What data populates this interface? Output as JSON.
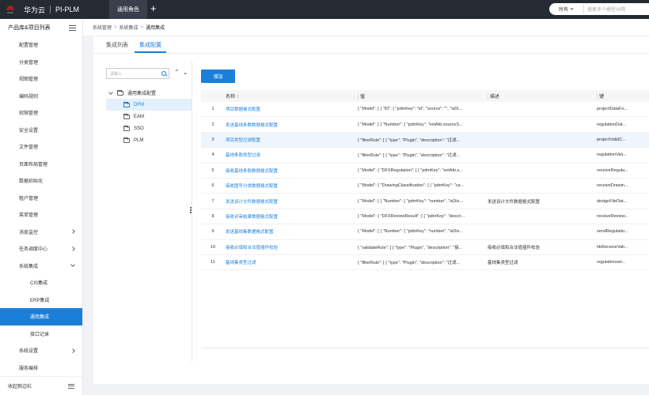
{
  "topbar": {
    "logo_text": "HUAWEI",
    "brand_company": "华为云",
    "brand_app": "PI-PLM",
    "active_tab": "通用角色",
    "add_tab_glyph": "+",
    "search_scope": "所有",
    "search_placeholder": "搜索多个模型分隔"
  },
  "sidebar": {
    "title": "产品库&项目列表",
    "items": [
      {
        "label": "配置管理"
      },
      {
        "label": "分类管理"
      },
      {
        "label": "视图管理"
      },
      {
        "label": "编码规则"
      },
      {
        "label": "权限管理"
      },
      {
        "label": "安全设置"
      },
      {
        "label": "文件管理"
      },
      {
        "label": "页面布局管理"
      },
      {
        "label": "数据初始化"
      },
      {
        "label": "租户管理"
      },
      {
        "label": "菜单管理"
      },
      {
        "label": "消息监控"
      },
      {
        "label": "任务调度中心"
      },
      {
        "label": "系统集成"
      },
      {
        "label": "CIS集成"
      },
      {
        "label": "ERP集成"
      },
      {
        "label": "通用集成"
      },
      {
        "label": "接口记录"
      },
      {
        "label": "系统设置"
      },
      {
        "label": "服务编排"
      }
    ],
    "footer": "收起侧边栏"
  },
  "breadcrumb": [
    "系统管理",
    "系统集成",
    "通用集成"
  ],
  "breadcrumb_sep": ">",
  "tabs": [
    "集成列表",
    "集成配置"
  ],
  "tree": {
    "search_placeholder": "请输入",
    "root": "通用集成配置",
    "children": [
      "DFM",
      "EAM",
      "SSO",
      "PLM"
    ]
  },
  "add_button": "增加",
  "table": {
    "headers": {
      "name": "名称",
      "value": "值",
      "desc": "描述",
      "key": "键"
    },
    "rows": [
      {
        "idx": "1",
        "name": "项目数据格式配置",
        "value": "{ \"Model\": [ { \"ID\": { \"pdmKey\": \"id\", \"source\": \"\", \"isDi...",
        "desc": "",
        "key": "projectDataFo..."
      },
      {
        "idx": "2",
        "name": "发送基线条数数据格式配置",
        "value": "{ \"Model\": [ { \"Number\": { \"pdmKey\": \"extAttr.sourceS...",
        "desc": "",
        "key": "regulationDat..."
      },
      {
        "idx": "3",
        "name": "项目类型过滤配置",
        "value": "{ \"filterRule\": [ { \"type\": \"Plugin\", \"description\": \"过滤...",
        "desc": "",
        "key": "projectValidC..."
      },
      {
        "idx": "4",
        "name": "基线条款类型过滤",
        "value": "{ \"filterRule\": [ { \"type\": \"Plugin\", \"description\": \"过滤...",
        "desc": "",
        "key": "regulationVali..."
      },
      {
        "idx": "5",
        "name": "接收基线条款数据格式配置",
        "value": "{ \"Model\": { \"DFXRegulation\": [ { \"pdmKey\": \"extAttr.s...",
        "desc": "",
        "key": "receiveRegula..."
      },
      {
        "idx": "6",
        "name": "接收图号分类数据格式配置",
        "value": "{ \"Model\": { \"DrawingClassification\": [ { \"pdmKey\": \"ca...",
        "desc": "",
        "key": "receiveDrawin..."
      },
      {
        "idx": "7",
        "name": "发送设计文件数据格式配置",
        "value": "{ \"Model\": [ { \"Number\": { \"pdmKey\": \"number\", \"isDis...",
        "desc": "发送设计文件数据格式配置",
        "key": "designFileDat..."
      },
      {
        "idx": "8",
        "name": "接收评审结果数据格式配置",
        "value": "{ \"Model\": { \"DFXReviewResult\": [ { \"pdmKey\": \"descri...",
        "desc": "",
        "key": "receiveReview..."
      },
      {
        "idx": "9",
        "name": "发送基线集数据格式配置",
        "value": "{ \"Model\": [ { \"Number\": { \"pdmKey\": \"number\", \"isDis...",
        "desc": "",
        "key": "sendRegulatio..."
      },
      {
        "idx": "10",
        "name": "接收必填和合法值插件校验",
        "value": "{ \"validateRule\": [ { \"type\": \"Plugin\", \"description\": \"接...",
        "desc": "接收必填和合法值插件校验",
        "key": "hbReceiveVali..."
      },
      {
        "idx": "11",
        "name": "基线集类型过滤",
        "value": "{ \"filterRule\": [ { \"type\": \"Plugin\", \"description\": \"过滤...",
        "desc": "基线集类型过滤",
        "key": "regulationset..."
      }
    ]
  },
  "colors": {
    "accent": "#1a7fd9",
    "topbar": "#262a33",
    "logo": "#e02020"
  }
}
